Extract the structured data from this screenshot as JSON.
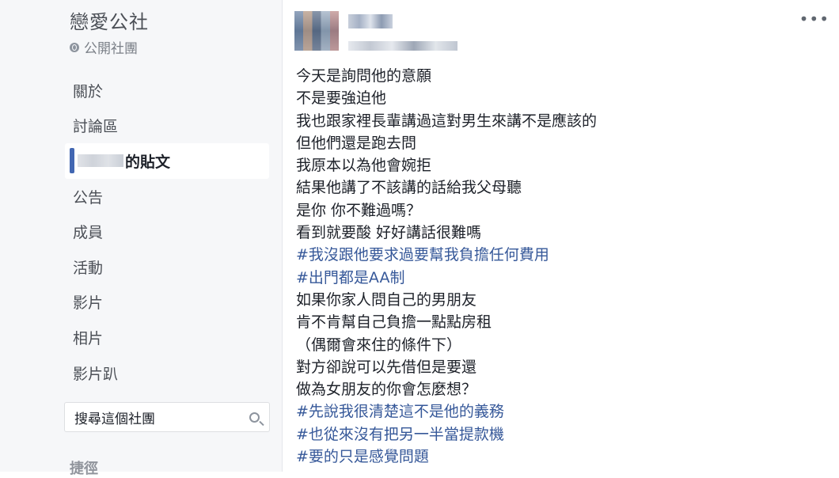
{
  "sidebar": {
    "group_title": "戀愛公社",
    "privacy": "公開社團",
    "nav": [
      {
        "label": "關於"
      },
      {
        "label": "討論區"
      },
      {
        "label": "的貼文",
        "active": true
      },
      {
        "label": "公告"
      },
      {
        "label": "成員"
      },
      {
        "label": "活動"
      },
      {
        "label": "影片"
      },
      {
        "label": "相片"
      },
      {
        "label": "影片趴"
      }
    ],
    "search_placeholder": "搜尋這個社團",
    "cut_label": "捷徑"
  },
  "post": {
    "lines": [
      {
        "text": "今天是詢問他的意願",
        "tag": false
      },
      {
        "text": "不是要強迫他",
        "tag": false
      },
      {
        "text": "我也跟家裡長輩講過這對男生來講不是應該的",
        "tag": false
      },
      {
        "text": "但他們還是跑去問",
        "tag": false
      },
      {
        "text": "我原本以為他會婉拒",
        "tag": false
      },
      {
        "text": "結果他講了不該講的話給我父母聽",
        "tag": false
      },
      {
        "text": "是你 你不難過嗎？",
        "tag": false
      },
      {
        "text": "看到就要酸 好好講話很難嗎",
        "tag": false
      },
      {
        "text": "#我沒跟他要求過要幫我負擔任何費用",
        "tag": true
      },
      {
        "text": "#出門都是AA制",
        "tag": true
      },
      {
        "text": "如果你家人問自己的男朋友",
        "tag": false
      },
      {
        "text": "肯不肯幫自己負擔一點點房租",
        "tag": false
      },
      {
        "text": "（偶爾會來住的條件下）",
        "tag": false
      },
      {
        "text": "對方卻說可以先借但是要還",
        "tag": false
      },
      {
        "text": "做為女朋友的你會怎麼想？",
        "tag": false
      },
      {
        "text": "#先說我很清楚這不是他的義務",
        "tag": true
      },
      {
        "text": "#也從來沒有把另一半當提款機",
        "tag": true
      },
      {
        "text": "#要的只是感覺問題",
        "tag": true
      }
    ]
  },
  "icons": {
    "more": "more-dots-icon",
    "privacy": "globe-icon",
    "search": "search-icon"
  },
  "colors": {
    "link": "#365899",
    "text": "#1d2129",
    "sidebar_bg": "#f6f7f9"
  }
}
